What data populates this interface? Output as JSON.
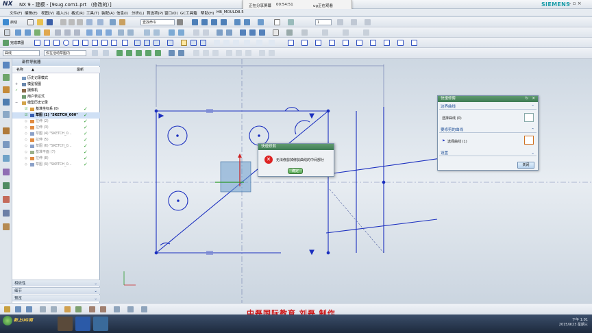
{
  "window": {
    "logo": "NX",
    "title": "NX 9 - 建模 - [9sug.com1.prt （修改的）]",
    "brand": "SIEMENS",
    "controls": "– ▫ ×"
  },
  "screenshare": {
    "label": "正在分享屏幕",
    "time": "00:54:51",
    "viewers": "ug正在观看"
  },
  "menubar": {
    "items": [
      "文件(F)",
      "编辑(E)",
      "视图(V)",
      "插入(S)",
      "格式(R)",
      "工具(T)",
      "装配(A)",
      "信息(I)",
      "分析(L)",
      "首选项(P)",
      "窗口(O)",
      "GC工具箱",
      "帮助(H)",
      "HB_MOULD8.5"
    ]
  },
  "toolbar": {
    "start_label": "启动",
    "command_finder": "查找命令",
    "layer_value": "1",
    "finish_sketch_label": "完成草图",
    "filter_value": "曲线",
    "scope_value": "仅在活动草图内"
  },
  "navigator": {
    "title": "部件导航器",
    "col_name": "名称",
    "col_latest": "最新",
    "items": [
      {
        "label": "历史记录模式",
        "checked": false
      },
      {
        "label": "模型视图",
        "checked": false
      },
      {
        "label": "摄像机",
        "checked": false
      },
      {
        "label": "用户表达式",
        "checked": false
      },
      {
        "label": "模型历史记录",
        "checked": false
      },
      {
        "label": "基准坐标系 (0)",
        "checked": true
      },
      {
        "label": "草图 (1) \"SKETCH_000\"",
        "checked": true
      },
      {
        "label": "拉伸 (2)",
        "checked": true
      },
      {
        "label": "拉伸 (3)",
        "checked": true
      },
      {
        "label": "草图 (4) \"SKETCH_0...",
        "checked": true
      },
      {
        "label": "拉伸 (5)",
        "checked": true
      },
      {
        "label": "草图 (6) \"SKETCH_0...",
        "checked": true
      },
      {
        "label": "基准平面 (7)",
        "checked": true
      },
      {
        "label": "拉伸 (8)",
        "checked": true
      },
      {
        "label": "草图 (9) \"SKETCH_0...",
        "checked": true
      }
    ],
    "panels": [
      "相依性",
      "细节",
      "预览"
    ]
  },
  "trim_dialog": {
    "title": "快速修剪",
    "section_boundary": "边界曲线",
    "select_curve_0": "选择曲线 (0)",
    "section_trim": "要修剪的曲线",
    "select_curve_1": "选择曲线 (1)",
    "section_settings": "设置",
    "close_label": "关闭"
  },
  "error_dialog": {
    "title": "快速修剪",
    "message": "无法修剪掉修剪曲线的中间部分",
    "ok_label": "确定"
  },
  "watermark": "中磊国际教育 刘磊 制作",
  "taskbar": {
    "brand": "新上UG网",
    "time": "下午 1:01",
    "date": "2015/9/23 星期三"
  },
  "colors": {
    "sketch_line": "#1b2fbf",
    "dialog_green": "#3e7b53",
    "error_red": "#d22222",
    "watermark_red": "#d01a1a"
  }
}
